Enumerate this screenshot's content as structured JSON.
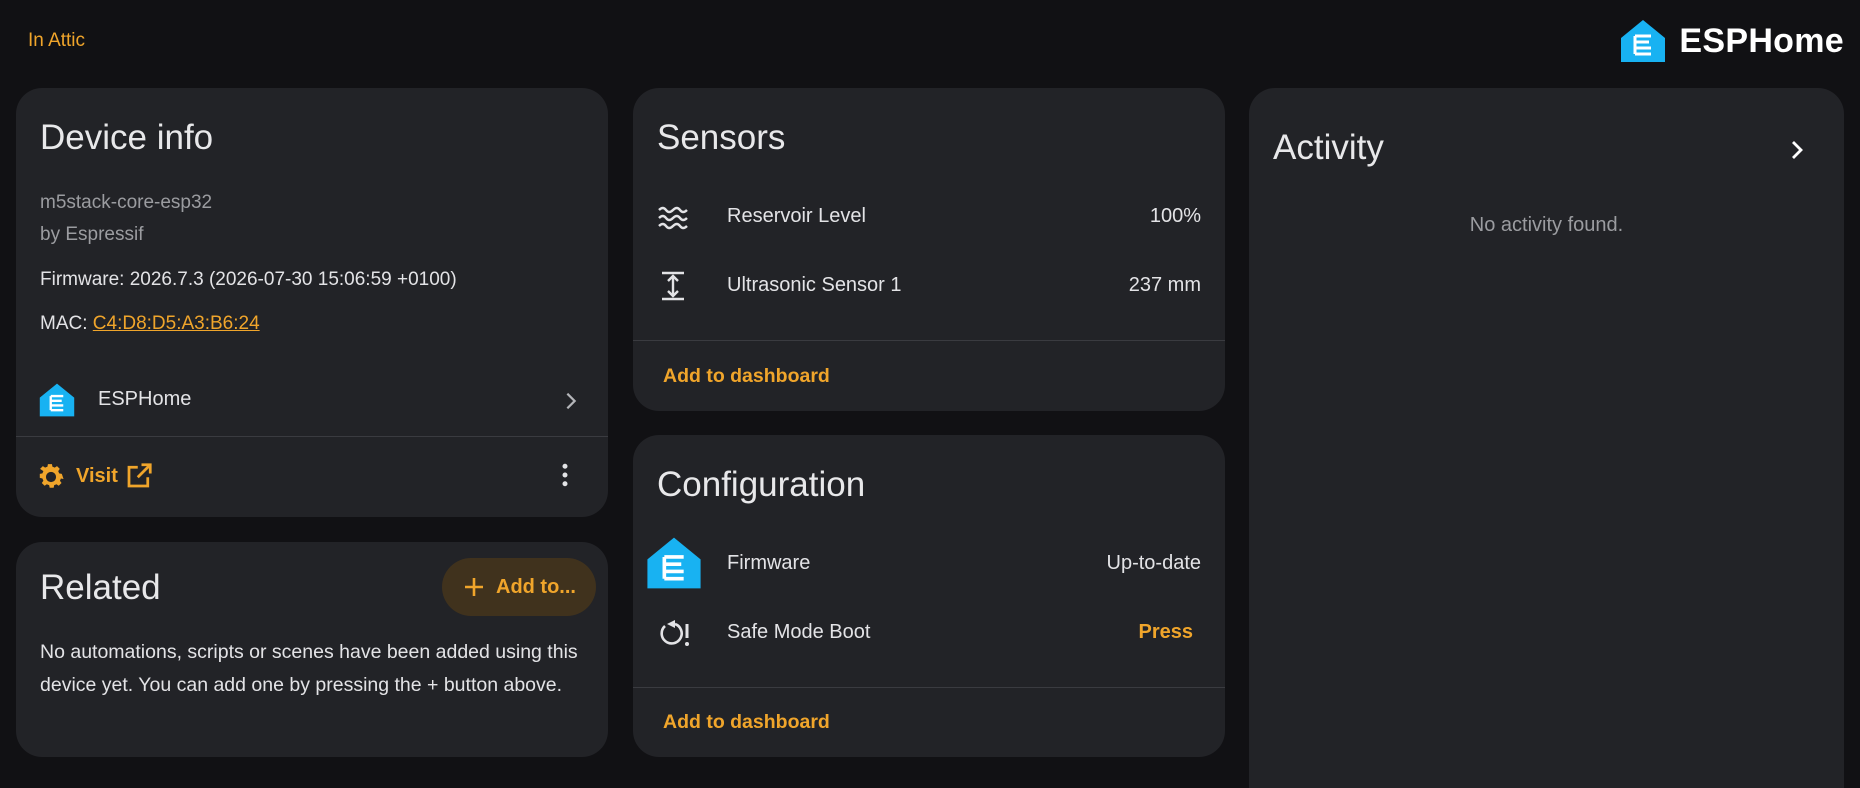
{
  "header": {
    "location": "In Attic",
    "brand": "ESPHome"
  },
  "device_info": {
    "title": "Device info",
    "model": "m5stack-core-esp32",
    "manufacturer": "by Espressif",
    "firmware": "Firmware: 2026.7.3 (2026-07-30 15:06:59 +0100)",
    "mac_label": "MAC: ",
    "mac_value": "C4:D8:D5:A3:B6:24",
    "integration": "ESPHome",
    "visit_label": "Visit"
  },
  "related": {
    "title": "Related",
    "add_label": "Add to...",
    "text": "No automations, scripts or scenes have been added using this device yet. You can add one by pressing the + button above."
  },
  "sensors": {
    "title": "Sensors",
    "items": [
      {
        "name": "Reservoir Level",
        "value": "100%",
        "icon": "water-level-icon"
      },
      {
        "name": "Ultrasonic Sensor 1",
        "value": "237 mm",
        "icon": "distance-icon"
      }
    ],
    "add_to_dashboard": "Add to dashboard"
  },
  "configuration": {
    "title": "Configuration",
    "items": [
      {
        "name": "Firmware",
        "value": "Up-to-date",
        "icon": "esphome-logo-icon"
      },
      {
        "name": "Safe Mode Boot",
        "value": "Press",
        "icon": "restart-alert-icon"
      }
    ],
    "add_to_dashboard": "Add to dashboard"
  },
  "activity": {
    "title": "Activity",
    "empty_text": "No activity found."
  },
  "colors": {
    "background": "#111114",
    "card": "#222327",
    "accent": "#f0a52b",
    "esphome_blue": "#18b2f2"
  }
}
